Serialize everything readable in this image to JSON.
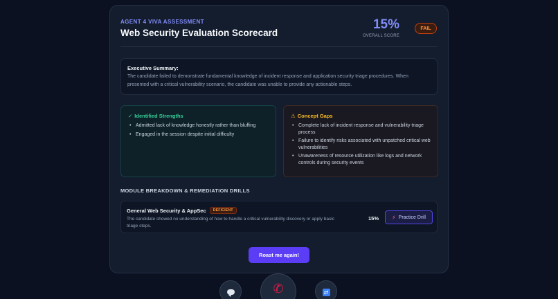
{
  "header": {
    "eyebrow": "AGENT 4 VIVA ASSESSMENT",
    "title": "Web Security Evaluation Scorecard",
    "score": "15%",
    "score_label": "OVERALL SCORE",
    "status_badge": "FAIL"
  },
  "summary": {
    "title": "Executive Summary:",
    "text": "The candidate failed to demonstrate fundamental knowledge of incident response and application security triage procedures. When presented with a critical vulnerability scenario, the candidate was unable to provide any actionable steps."
  },
  "strengths": {
    "icon": "check-icon",
    "icon_glyph": "✓",
    "title": "Identified Strengths",
    "items": [
      "Admitted lack of knowledge honestly rather than bluffing",
      "Engaged in the session despite initial difficulty"
    ]
  },
  "gaps": {
    "icon": "warning-icon",
    "icon_glyph": "⚠",
    "title": "Concept Gaps",
    "items": [
      "Complete lack of incident response and vulnerability triage process",
      "Failure to identify risks associated with unpatched critical web vulnerabilities",
      "Unawareness of resource utilization like logs and network controls during security events"
    ]
  },
  "modules": {
    "heading": "MODULE BREAKDOWN & REMEDIATION DRILLS",
    "items": [
      {
        "name": "General Web Security & AppSec",
        "badge": "DEFICIENT",
        "description": "The candidate showed no understanding of how to handle a critical vulnerability discovery or apply basic triage steps.",
        "score": "15%",
        "drill_icon": "lightning-icon",
        "drill_icon_glyph": "⚡",
        "drill_label": "Practice Drill"
      }
    ]
  },
  "actions": {
    "roast_label": "Roast me again!",
    "chat_icon": "chat-bubble-icon",
    "call_icon": "phone-icon",
    "call_icon_glyph": "✆",
    "switch_icon": "switch-icon",
    "switch_icon_glyph": "⇄"
  },
  "colors": {
    "background": "#0b1120",
    "card": "#141d2e",
    "accent": "#818cf8",
    "fail": "#fb923c",
    "strength": "#34d399",
    "gap": "#fbbf24",
    "primary_button": "#5b3df5",
    "call_icon": "#e11d48"
  }
}
